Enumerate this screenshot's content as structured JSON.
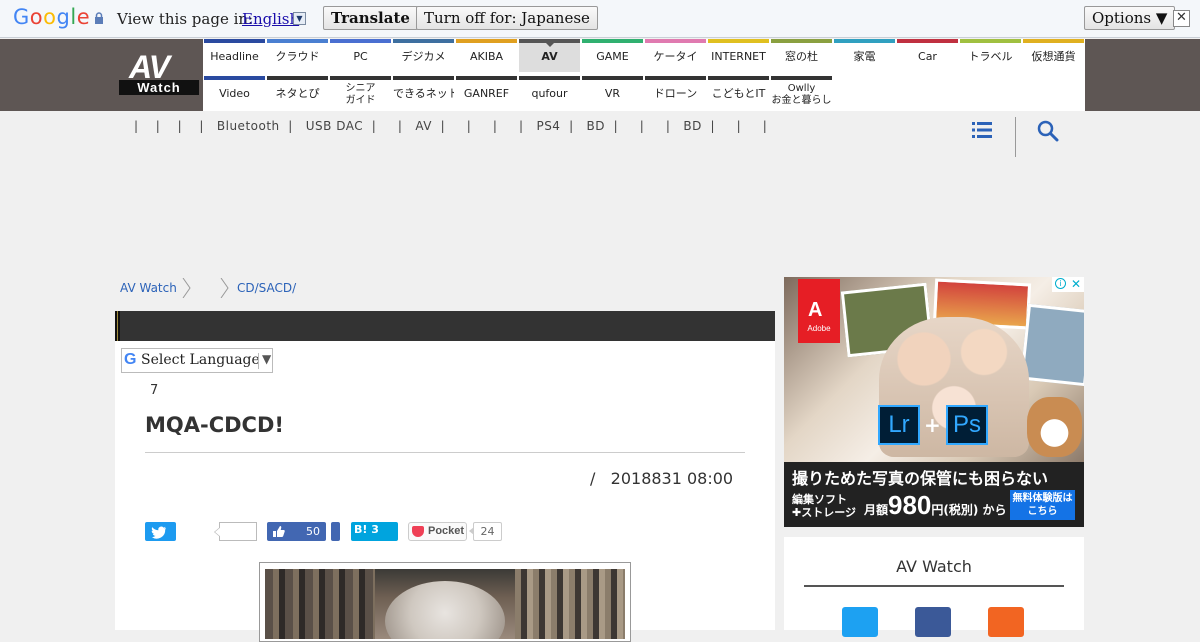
{
  "translate_bar": {
    "logo": "Google",
    "prompt": "View this page in:",
    "language": "English",
    "translate_label": "Translate",
    "turn_off_label": "Turn off for: Japanese",
    "options_label": "Options ▼",
    "close_label": "✕"
  },
  "site": {
    "logo_top": "AV",
    "logo_bottom": "Watch"
  },
  "nav": {
    "row1": [
      {
        "label": "Headline",
        "color": "#2a4aa0"
      },
      {
        "label": "クラウド",
        "color": "#4a7fd1"
      },
      {
        "label": "PC",
        "color": "#4a6fd1"
      },
      {
        "label": "デジカメ",
        "color": "#3e6fa0"
      },
      {
        "label": "AKIBA",
        "color": "#e0a020"
      },
      {
        "label": "AV",
        "color": "#555555"
      },
      {
        "label": "GAME",
        "color": "#30b070"
      },
      {
        "label": "ケータイ",
        "color": "#e07ab0"
      },
      {
        "label": "INTERNET",
        "color": "#e0c020"
      },
      {
        "label": "窓の杜",
        "color": "#8aa040"
      },
      {
        "label": "家電",
        "color": "#30a0c0"
      },
      {
        "label": "Car",
        "color": "#c03040"
      },
      {
        "label": "トラベル",
        "color": "#a0c040"
      },
      {
        "label": "仮想通貨",
        "color": "#e0b020"
      }
    ],
    "row2": [
      {
        "label": "Video",
        "color": "#2a4aa0"
      },
      {
        "label": "ネタとぴ",
        "color": "#333333"
      },
      {
        "label": "シニア\nガイド",
        "color": "#333333"
      },
      {
        "label": "できるネット",
        "color": "#333333"
      },
      {
        "label": "GANREF",
        "color": "#333333"
      },
      {
        "label": "qufour",
        "color": "#333333"
      },
      {
        "label": "VR",
        "color": "#333333"
      },
      {
        "label": "ドローン",
        "color": "#333333"
      },
      {
        "label": "こどもとIT",
        "color": "#333333"
      },
      {
        "label": "Owlly\nお金と暮らし",
        "color": "#333333"
      }
    ],
    "active": "AV"
  },
  "subnav_text": "|    |    |    |   Bluetooth  |   USB DAC  |     |   AV  |     |     |     |   PS4  |   BD  |     |     |   BD  |     |     |",
  "breadcrumb": [
    "AV Watch",
    "",
    "CD/SACD/"
  ],
  "article": {
    "select_language": "Select Language",
    "select_arrow": "▼",
    "g_letter": "G",
    "count": "7",
    "title": "MQA-CDCD!",
    "meta": "/   2018831 08:00",
    "like_count": "50",
    "hatena_label": "B! 3",
    "pocket_label": "Pocket",
    "pocket_count": "24"
  },
  "ad": {
    "brand": "Adobe",
    "headline": "撮りためた写真の保管にも困らない",
    "software": "編集ソフト\n✚ストレージ",
    "price_prefix": "月額",
    "price": "980",
    "price_suffix": "円(税別) から",
    "cta": "無料体験版は\nこちら",
    "lr": "Lr",
    "ps": "Ps",
    "info": "i",
    "close": "✕"
  },
  "sidebar": {
    "title": "AV Watch"
  }
}
